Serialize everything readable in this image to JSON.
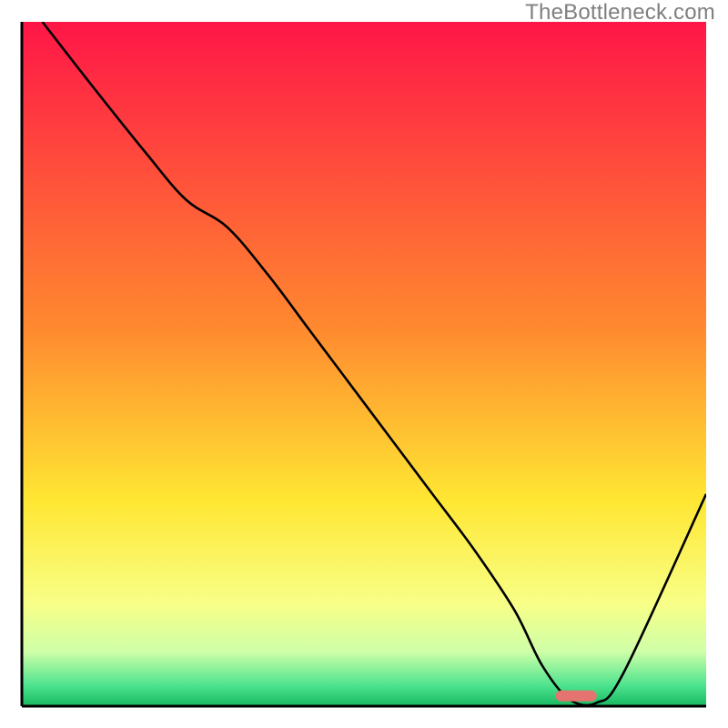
{
  "watermark": "TheBottleneck.com",
  "chart_data": {
    "type": "line",
    "title": "",
    "xlabel": "",
    "ylabel": "",
    "xlim": [
      0,
      100
    ],
    "ylim": [
      0,
      100
    ],
    "series": [
      {
        "name": "bottleneck-curve",
        "x": [
          3,
          10,
          18,
          24,
          30,
          36,
          42,
          48,
          54,
          60,
          66,
          72,
          76,
          80,
          84,
          88,
          100
        ],
        "values": [
          100,
          91,
          81,
          74,
          70,
          63,
          55,
          47,
          39,
          31,
          23,
          14,
          6,
          1,
          0.5,
          5,
          31
        ],
        "notes": "values are approximate percentage heights read visually off the image since the figure has no axis ticks or labels"
      },
      {
        "name": "optimal-marker",
        "x": [
          78,
          84
        ],
        "values": [
          1.5,
          1.5
        ],
        "notes": "pink pill near curve minimum"
      }
    ],
    "background_gradient": {
      "stops": [
        {
          "offset": 0,
          "color": "#ff1647"
        },
        {
          "offset": 45,
          "color": "#ff8a2f"
        },
        {
          "offset": 70,
          "color": "#ffe733"
        },
        {
          "offset": 85,
          "color": "#f8ff87"
        },
        {
          "offset": 92,
          "color": "#cfffa8"
        },
        {
          "offset": 97,
          "color": "#4de38e"
        },
        {
          "offset": 100,
          "color": "#18b861"
        }
      ]
    },
    "colors": {
      "curve": "#000000",
      "marker": "#e5736f",
      "axis": "#000000"
    }
  }
}
